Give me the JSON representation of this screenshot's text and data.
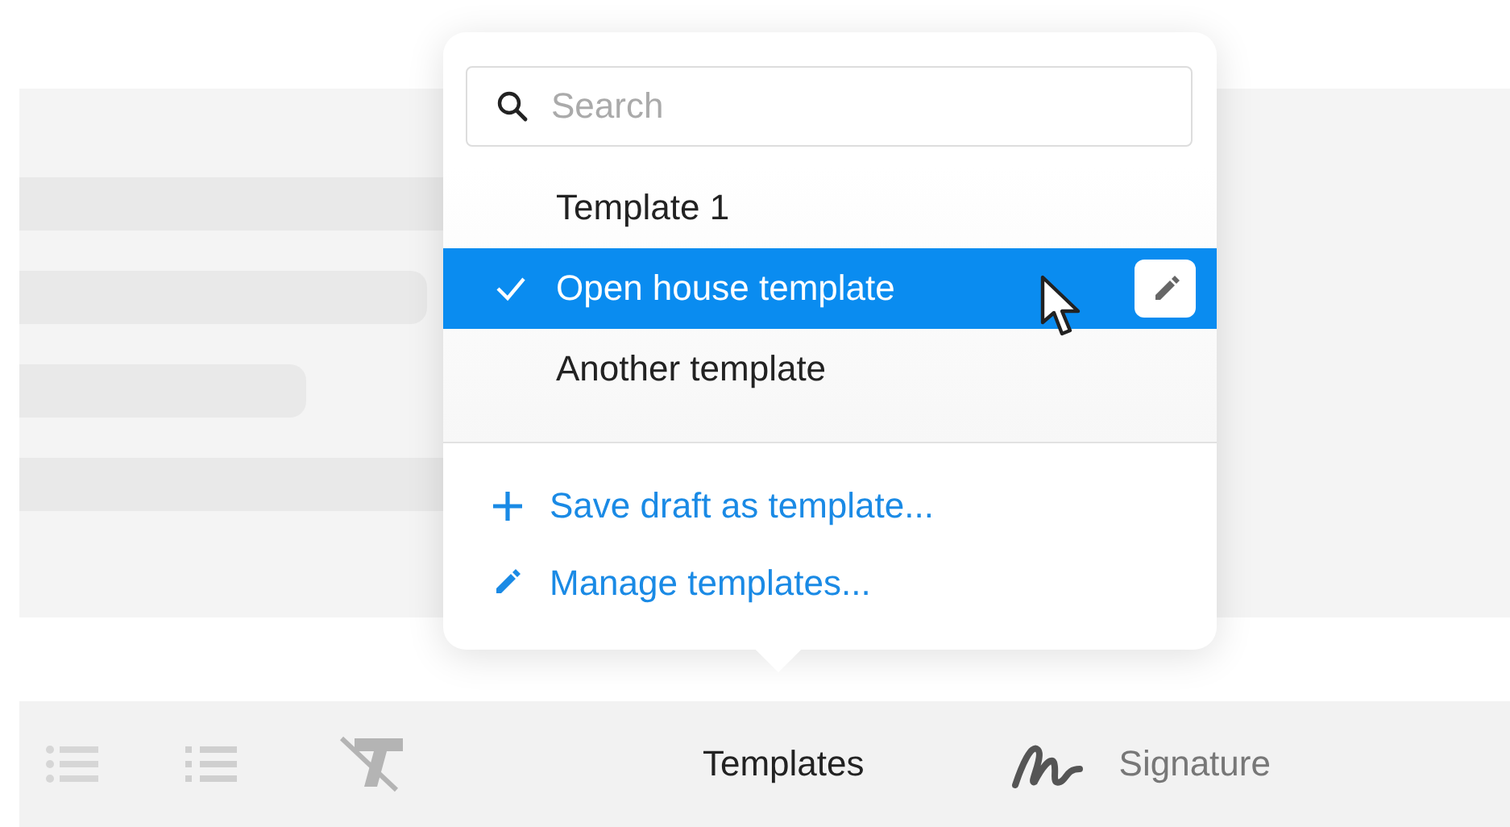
{
  "search": {
    "placeholder": "Search"
  },
  "templates": [
    {
      "label": "Template 1",
      "selected": false
    },
    {
      "label": "Open house template",
      "selected": true
    },
    {
      "label": "Another template",
      "selected": false
    }
  ],
  "actions": [
    {
      "kind": "add",
      "label": "Save draft as template..."
    },
    {
      "kind": "edit",
      "label": "Manage templates..."
    }
  ],
  "toolbar": [
    {
      "kind": "bullets"
    },
    {
      "kind": "numbers"
    },
    {
      "kind": "clear-format"
    },
    {
      "kind": "text",
      "label": "Templates"
    },
    {
      "kind": "signature",
      "label": "Signature"
    }
  ]
}
